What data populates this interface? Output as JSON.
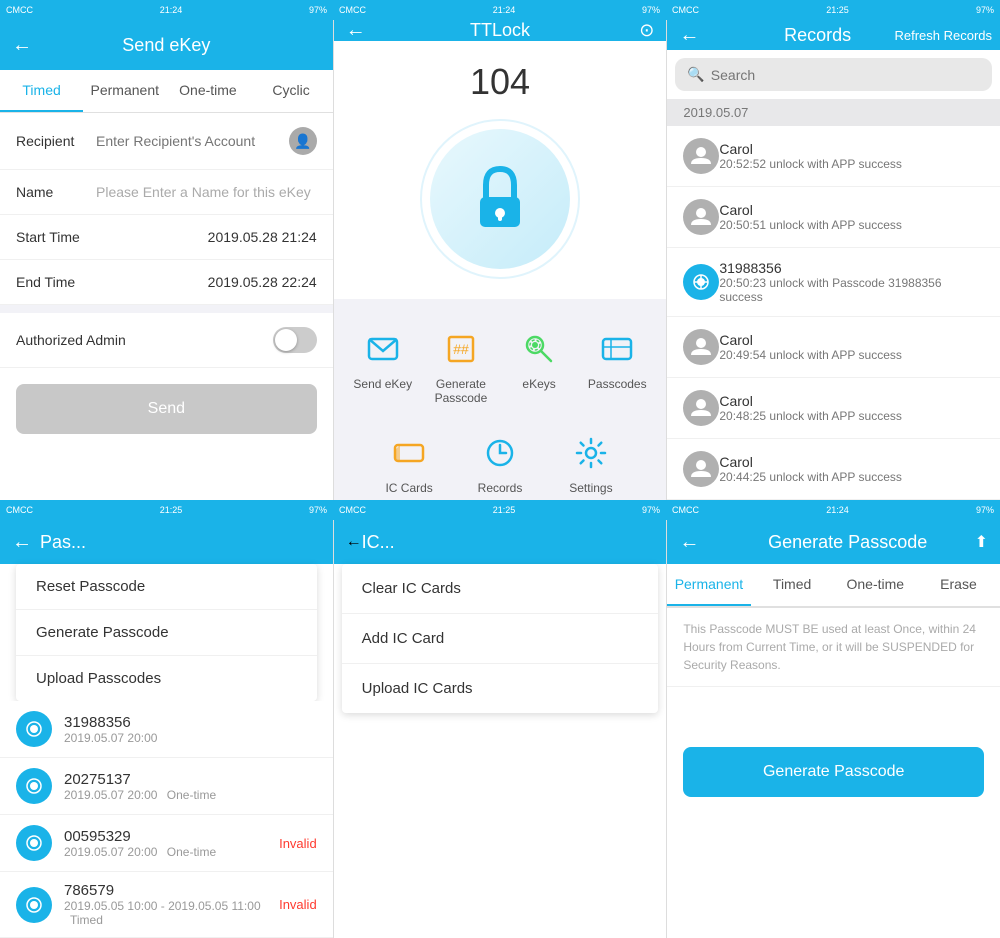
{
  "status": {
    "carrier1": "CMCC",
    "time1": "21:24",
    "battery1": "97%",
    "carrier2": "CMCC",
    "time2": "21:24",
    "battery2": "97%",
    "carrier3": "CMCC",
    "time3": "21:25",
    "battery3": "97%",
    "carrier4": "CMCC",
    "time4": "21:25",
    "battery4": "97%",
    "carrier5": "CMCC",
    "time5": "21:25",
    "battery5": "97%",
    "carrier6": "CMCC",
    "time6": "21:24",
    "battery6": "97%"
  },
  "panel1_top": {
    "title": "Send eKey",
    "tabs": [
      "Timed",
      "Permanent",
      "One-time",
      "Cyclic"
    ],
    "active_tab": "Timed",
    "form": {
      "recipient_label": "Recipient",
      "recipient_placeholder": "Enter Recipient's Account",
      "name_label": "Name",
      "name_placeholder": "Please Enter a Name for this eKey",
      "start_label": "Start Time",
      "start_value": "2019.05.28 21:24",
      "end_label": "End Time",
      "end_value": "2019.05.28 22:24",
      "auth_label": "Authorized Admin"
    },
    "send_button": "Send"
  },
  "panel2_top": {
    "title": "TTLock",
    "lock_number": "104",
    "menu_items": [
      {
        "label": "Send eKey",
        "icon": "send-ekey"
      },
      {
        "label": "Generate Passcode",
        "icon": "passcode"
      },
      {
        "label": "eKeys",
        "icon": "ekeys"
      },
      {
        "label": "Passcodes",
        "icon": "passcodes"
      },
      {
        "label": "IC Cards",
        "icon": "ic-cards"
      },
      {
        "label": "Records",
        "icon": "records"
      },
      {
        "label": "Settings",
        "icon": "settings"
      }
    ]
  },
  "panel3_top": {
    "title": "Records",
    "refresh_label": "Refresh Records",
    "search_placeholder": "Search",
    "date_header": "2019.05.07",
    "records": [
      {
        "name": "Carol",
        "time": "20:52:52 unlock with APP success",
        "type": "person"
      },
      {
        "name": "Carol",
        "time": "20:50:51 unlock with APP success",
        "type": "person"
      },
      {
        "name": "31988356",
        "time": "20:50:23 unlock with Passcode 31988356 success",
        "type": "ic"
      },
      {
        "name": "Carol",
        "time": "20:49:54 unlock with APP success",
        "type": "person"
      },
      {
        "name": "Carol",
        "time": "20:48:25 unlock with APP success",
        "type": "person"
      },
      {
        "name": "Carol",
        "time": "20:44:25 unlock with APP success",
        "type": "person"
      }
    ]
  },
  "panel1_bottom": {
    "title": "Pas...",
    "dropdown": {
      "items": [
        "Reset Passcode",
        "Generate Passcode",
        "Upload Passcodes"
      ]
    },
    "passcodes": [
      {
        "number": "31988356",
        "date": "2019.05.07 20:00",
        "type": "",
        "status": ""
      },
      {
        "number": "20275137",
        "date": "2019.05.07 20:00",
        "type": "One-time",
        "status": ""
      },
      {
        "number": "00595329",
        "date": "2019.05.07 20:00",
        "type": "One-time",
        "status": "Invalid"
      },
      {
        "number": "786579",
        "date": "2019.05.05 10:00 - 2019.05.05 11:00",
        "type": "Timed",
        "status": "Invalid"
      }
    ]
  },
  "panel2_bottom": {
    "title": "IC...",
    "dropdown": {
      "items": [
        "Clear IC Cards",
        "Add IC Card",
        "Upload IC Cards"
      ]
    }
  },
  "panel3_bottom": {
    "title": "Generate Passcode",
    "export_icon": "export",
    "tabs": [
      "Permanent",
      "Timed",
      "One-time",
      "Erase"
    ],
    "active_tab": "Permanent",
    "note": "This Passcode MUST BE used at least Once, within 24 Hours from Current Time, or it will be SUSPENDED for Security Reasons.",
    "generate_button": "Generate Passcode"
  }
}
